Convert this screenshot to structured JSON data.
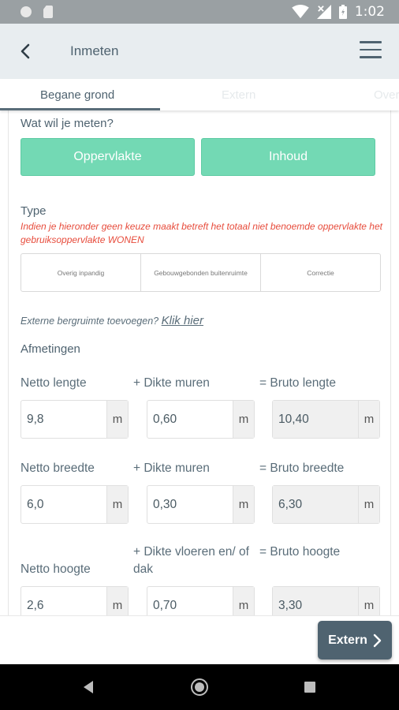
{
  "status_bar": {
    "time": "1:02"
  },
  "app_bar": {
    "title": "Inmeten"
  },
  "tabs": [
    "Begane grond",
    "Extern",
    "Over"
  ],
  "question": "Wat wil je meten?",
  "choices": [
    "Oppervlakte",
    "Inhoud"
  ],
  "type_label": "Type",
  "type_warning": "Indien je hieronder geen keuze maakt betreft het totaal niet benoemde oppervlakte het gebruiksoppervlakte WONEN",
  "type_options": [
    "Overig inpandig",
    "Gebouwgebonden buitenruimte",
    "Correctie"
  ],
  "extern_prompt": "Externe bergruimte toevoegen?",
  "extern_link": "Klik hier",
  "afmetingen_label": "Afmetingen",
  "rows": [
    {
      "labels": [
        "Netto lengte",
        "+ Dikte muren",
        "= Bruto lengte"
      ],
      "values": [
        "9,8",
        "0,60",
        "10,40"
      ],
      "unit": "m"
    },
    {
      "labels": [
        "Netto breedte",
        "+ Dikte muren",
        "= Bruto breedte"
      ],
      "values": [
        "6,0",
        "0,30",
        "6,30"
      ],
      "unit": "m"
    },
    {
      "labels": [
        "Netto hoogte",
        "+ Dikte vloeren en/ of dak",
        "= Bruto hoogte"
      ],
      "values": [
        "2,6",
        "0,70",
        "3,30"
      ],
      "unit": "m"
    }
  ],
  "next_button": "Extern",
  "colors": {
    "accent_green": "#73d9b4",
    "primary_dark": "#4f6370",
    "warning_red": "#e74c3c"
  }
}
